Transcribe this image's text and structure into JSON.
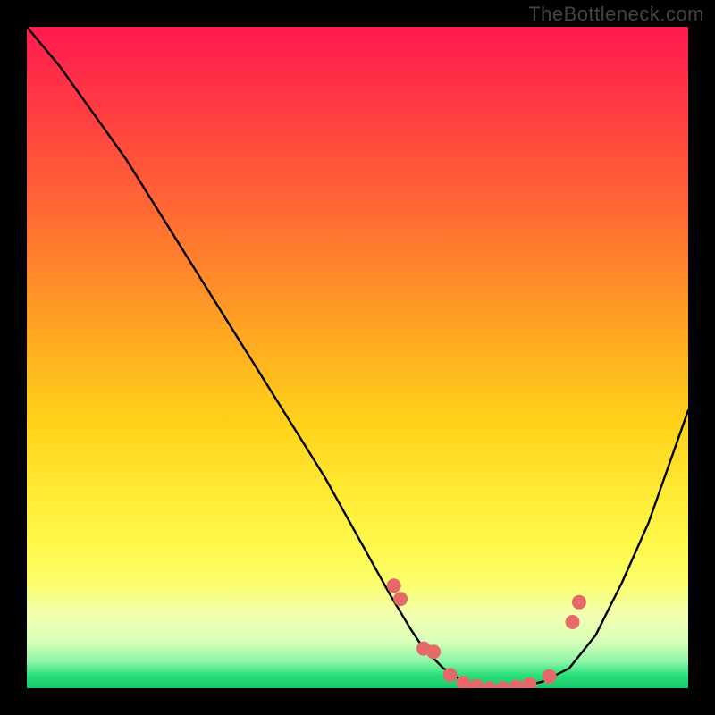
{
  "watermark": "TheBottleneck.com",
  "chart_data": {
    "type": "line",
    "title": "",
    "xlabel": "",
    "ylabel": "",
    "xlim": [
      0,
      100
    ],
    "ylim": [
      0,
      100
    ],
    "grid": false,
    "series": [
      {
        "name": "bottleneck-curve",
        "color": "#000000",
        "x": [
          0,
          5,
          10,
          15,
          20,
          25,
          30,
          35,
          40,
          45,
          50,
          55,
          58,
          60,
          63,
          66,
          70,
          74,
          78,
          82,
          86,
          90,
          94,
          100
        ],
        "y": [
          100,
          94,
          87,
          80,
          72,
          64,
          56,
          48,
          40,
          32,
          23,
          14,
          9,
          6,
          3,
          1,
          0,
          0,
          1,
          3,
          8,
          16,
          25,
          42
        ]
      }
    ],
    "markers": {
      "name": "highlight-dots",
      "color": "#e46a6a",
      "radius": 8,
      "x": [
        55.5,
        56.5,
        60,
        61.5,
        64,
        66,
        68,
        70,
        72,
        74,
        76,
        79,
        82.5,
        83.5
      ],
      "y": [
        15.5,
        13.5,
        6,
        5.5,
        2,
        0.8,
        0.3,
        0,
        0,
        0.2,
        0.6,
        1.8,
        10,
        13
      ]
    },
    "gradient": {
      "direction": "vertical",
      "stops": [
        {
          "pos": 0.0,
          "color": "#ff1a4d"
        },
        {
          "pos": 0.28,
          "color": "#ff6a33"
        },
        {
          "pos": 0.6,
          "color": "#ffd21a"
        },
        {
          "pos": 0.84,
          "color": "#fbff6a"
        },
        {
          "pos": 0.96,
          "color": "#8cf5a8"
        },
        {
          "pos": 1.0,
          "color": "#18c86c"
        }
      ]
    }
  }
}
